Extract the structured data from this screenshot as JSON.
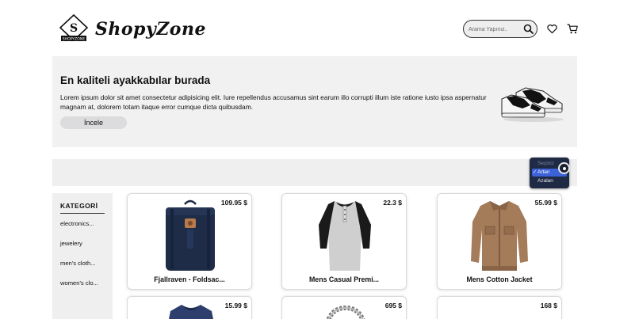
{
  "brand": {
    "name": "ShopyZone",
    "mark_letter": "S",
    "mark_caption": "SHOPYZONE"
  },
  "search": {
    "placeholder": "Arama Yapınız..",
    "value": ""
  },
  "icons": {
    "search": "search-icon",
    "favorites": "heart-icon",
    "cart": "cart-icon"
  },
  "hero": {
    "title": "En kaliteli ayakkabılar burada",
    "text": "Lorem ipsum dolor sit amet consectetur adipisicing elit. Iure repellendus accusamus sint earum illo corrupti illum iste ratione iusto ipsa aspernatur magnam at, dolorem totam itaque error cumque dicta quibusdam.",
    "button_label": "İncele"
  },
  "sort": {
    "options": [
      "Seçiniz",
      "Artan",
      "Azalan"
    ],
    "selected": "Artan"
  },
  "sidebar": {
    "title": "KATEGORİ",
    "items": [
      {
        "label": "electronics..."
      },
      {
        "label": "jewelery"
      },
      {
        "label": "men's cloth..."
      },
      {
        "label": "women's clo..."
      }
    ]
  },
  "products": [
    {
      "title": "Fjallraven - Foldsac...",
      "price": "109.95 $"
    },
    {
      "title": "Mens Casual Premi...",
      "price": "22.3 $"
    },
    {
      "title": "Mens Cotton Jacket",
      "price": "55.99 $"
    },
    {
      "title": "",
      "price": "15.99 $"
    },
    {
      "title": "",
      "price": "695 $"
    },
    {
      "title": "",
      "price": "168 $"
    }
  ],
  "colors": {
    "accent": "#3b62d9",
    "dropdown_bg": "#1f2a44",
    "panel_bg": "#f1f1f2"
  }
}
